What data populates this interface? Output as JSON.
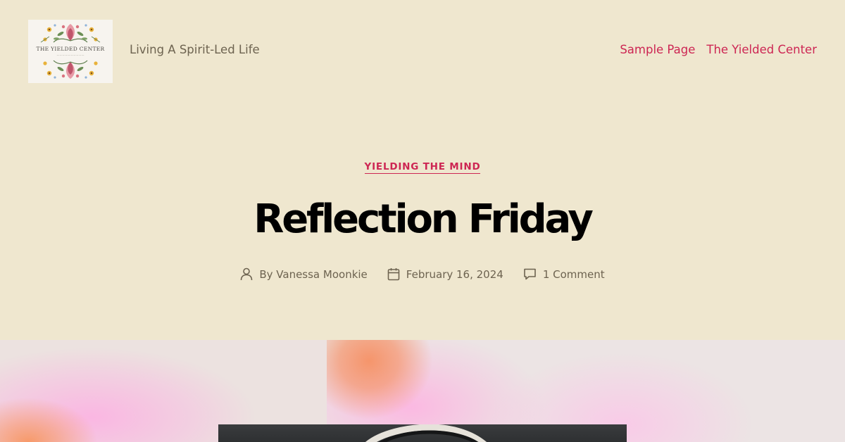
{
  "site": {
    "logo_text": "THE YIELDED CENTER",
    "tagline": "Living A Spirit-Led Life"
  },
  "nav": {
    "items": [
      {
        "label": "Sample Page"
      },
      {
        "label": "The Yielded Center"
      }
    ]
  },
  "post": {
    "category": "YIELDING THE MIND",
    "title": "Reflection Friday",
    "author": "By Vanessa Moonkie",
    "date": "February 16, 2024",
    "comments": "1 Comment"
  },
  "colors": {
    "background": "#efe7cf",
    "accent": "#cd2653",
    "meta_text": "#6d6350",
    "title": "#000000"
  },
  "icons": {
    "author": "user-icon",
    "date": "calendar-icon",
    "comments": "comment-bubble-icon"
  }
}
